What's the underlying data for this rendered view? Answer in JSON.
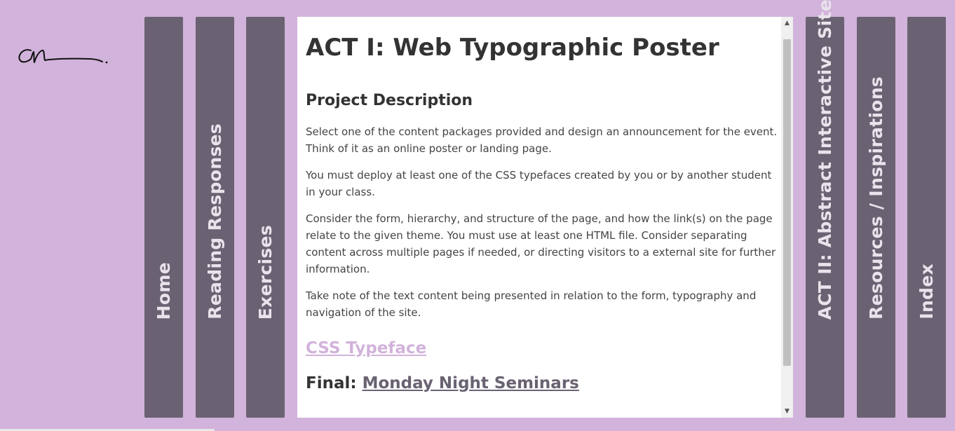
{
  "nav": {
    "left": [
      {
        "label": "Home"
      },
      {
        "label": "Reading Responses"
      },
      {
        "label": "Exercises"
      }
    ],
    "right": [
      {
        "label": "ACT II: Abstract Interactive Site"
      },
      {
        "label": "Resources / Inspirations"
      },
      {
        "label": "Index"
      }
    ]
  },
  "main": {
    "title": "ACT I: Web Typographic Poster",
    "section_heading": "Project Description",
    "paragraphs": [
      "Select one of the content packages provided and design an announcement for the event. Think of it as an online poster or landing page.",
      "You must deploy at least one of the CSS typefaces created by you or by another student in your class.",
      "Consider the form, hierarchy, and structure of the page, and how the link(s) on the page relate to the given theme. You must use at least one HTML file. Consider separating content across multiple pages if needed, or directing visitors to a external site for further information.",
      "Take note of the text content being presented in relation to the form, typography and navigation of the site."
    ],
    "link_css": "CSS Typeface",
    "final_label": "Final:",
    "final_link": "Monday Night Seminars"
  },
  "scrollbar": {
    "up_arrow": "▲",
    "down_arrow": "▼"
  },
  "colors": {
    "background": "#d2b3db",
    "tab": "#6a6272",
    "link": "#d2b3db"
  }
}
